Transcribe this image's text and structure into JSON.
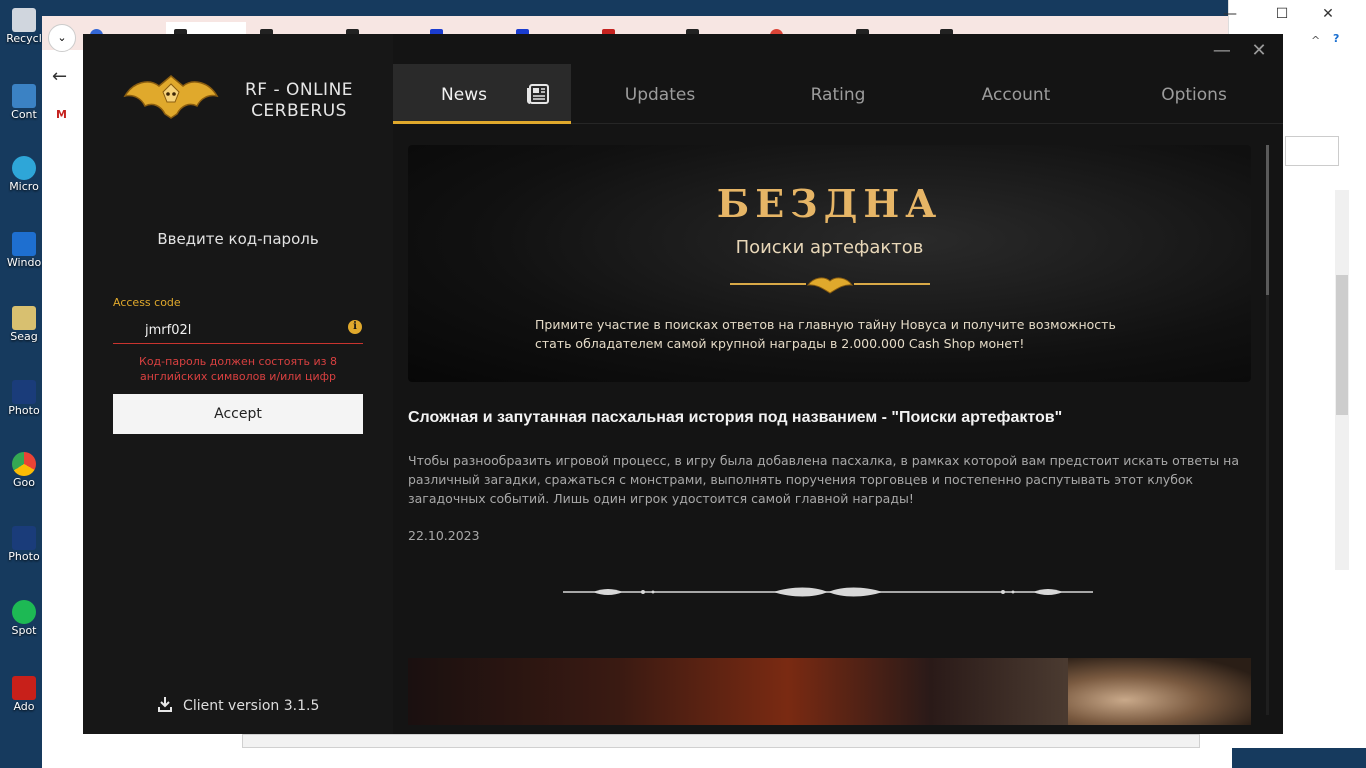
{
  "desktop": {
    "icons": [
      {
        "label": "Recycl",
        "color": "#d0d6de"
      },
      {
        "label": "Cont",
        "color": "#3b82c4"
      },
      {
        "label": "Micro",
        "color": "#2ea6d8"
      },
      {
        "label": "Windo",
        "color": "#1e6fd0"
      },
      {
        "label": "Seag",
        "color": "#d8c070"
      },
      {
        "label": "Photo",
        "color": "#1a3c7a"
      },
      {
        "label": "Goo",
        "color": "#e0e0e0"
      },
      {
        "label": "Photo",
        "color": "#1a3c7a"
      },
      {
        "label": "Spot",
        "color": "#1db954"
      },
      {
        "label": "Ado",
        "color": "#c8201a"
      }
    ]
  },
  "launcher": {
    "logo_text_1": "RF - ONLINE",
    "logo_text_2": "CERBERUS",
    "login_title": "Введите код-пароль",
    "access_label": "Access code",
    "access_value": "jmrf02l",
    "access_error": "Код-пароль должен состоять из 8 английских символов и/или цифр",
    "accept_label": "Accept",
    "client_version": "Client version 3.1.5",
    "tabs": [
      {
        "label": "News"
      },
      {
        "label": "Updates"
      },
      {
        "label": "Rating"
      },
      {
        "label": "Account"
      },
      {
        "label": "Options"
      }
    ],
    "banner": {
      "title": "БЕЗДНА",
      "subtitle": "Поиски артефактов",
      "text": "Примите участие в поисках ответов на главную тайну Новуса и получите возможность стать обладателем самой крупной награды в 2.000.000 Cash Shop монет!"
    },
    "article": {
      "title": "Сложная и запутанная пасхальная история под названием - \"Поиски артефактов\"",
      "body": "Чтобы разнообразить игровой процесс, в игру была добавлена пасхалка, в рамках которой вам предстоит искать ответы на различный загадки, сражаться с монстрами, выполнять поручения торговцев и постепенно распутывать этот клубок загадочных событий. Лишь один игрок удостоится самой главной награды!",
      "date": "22.10.2023"
    }
  },
  "colors": {
    "accent": "#e0a92c",
    "error": "#d84040"
  }
}
